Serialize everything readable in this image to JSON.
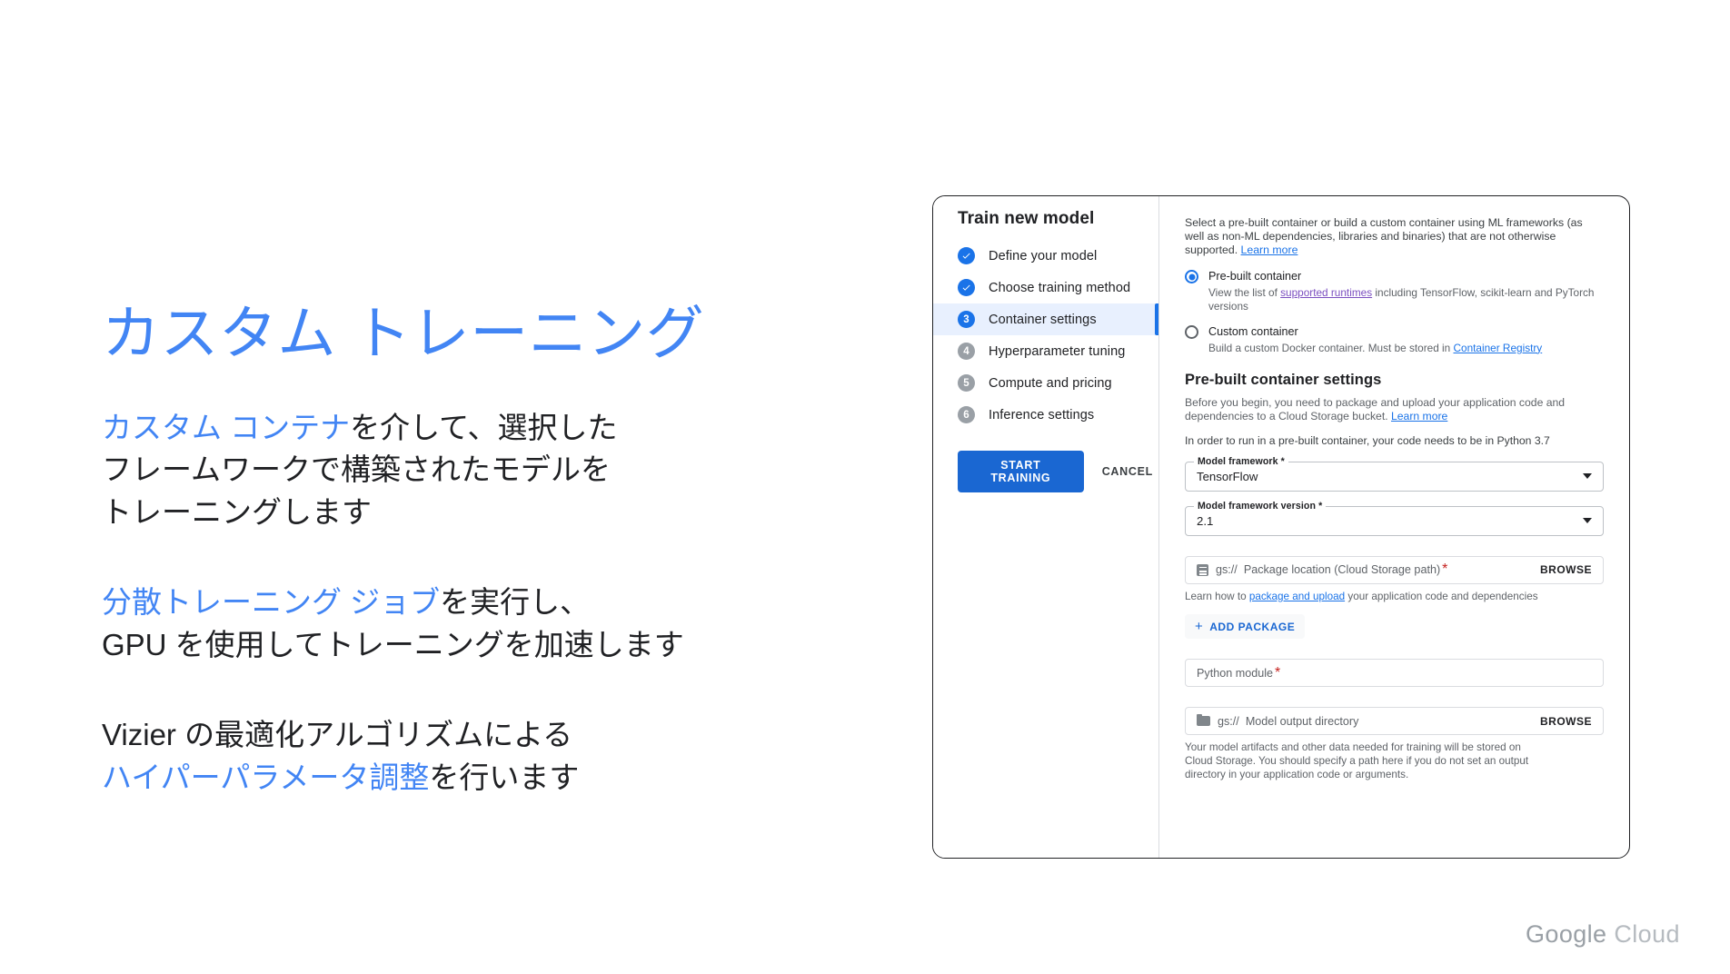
{
  "slide": {
    "headline": "カスタム トレーニング",
    "paragraphs": [
      {
        "lines": [
          {
            "segments": [
              {
                "text": "カスタム コンテナ",
                "accent": true
              },
              {
                "text": "を介して、選択した",
                "accent": false
              }
            ]
          },
          {
            "segments": [
              {
                "text": "フレームワークで構築されたモデルを",
                "accent": false
              }
            ]
          },
          {
            "segments": [
              {
                "text": "トレーニングします",
                "accent": false
              }
            ]
          }
        ]
      },
      {
        "lines": [
          {
            "segments": [
              {
                "text": "分散トレーニング ジョブ",
                "accent": true
              },
              {
                "text": "を実行し、",
                "accent": false
              }
            ]
          },
          {
            "segments": [
              {
                "text": "GPU を使用してトレーニングを加速します",
                "accent": false
              }
            ]
          }
        ]
      },
      {
        "lines": [
          {
            "segments": [
              {
                "text": "Vizier の最適化アルゴリズムによる",
                "accent": false
              }
            ]
          },
          {
            "segments": [
              {
                "text": "ハイパーパラメータ調整",
                "accent": true
              },
              {
                "text": "を行います",
                "accent": false
              }
            ]
          }
        ]
      }
    ],
    "logo": {
      "strong": "Google",
      "light": "Cloud"
    }
  },
  "dialog": {
    "nav": {
      "title": "Train new model",
      "steps": [
        {
          "number": "1",
          "label": "Define your model",
          "state": "done"
        },
        {
          "number": "2",
          "label": "Choose training method",
          "state": "done"
        },
        {
          "number": "3",
          "label": "Container settings",
          "state": "current"
        },
        {
          "number": "4",
          "label": "Hyperparameter tuning",
          "state": "todo"
        },
        {
          "number": "5",
          "label": "Compute and pricing",
          "state": "todo"
        },
        {
          "number": "6",
          "label": "Inference settings",
          "state": "todo"
        }
      ],
      "primary_button": "START TRAINING",
      "cancel_button": "CANCEL"
    },
    "pane": {
      "intro": {
        "text_before": "Select a pre-built container or build a custom container using ML frameworks (as well as non-ML dependencies, libraries and binaries) that are not otherwise supported. ",
        "link": "Learn more"
      },
      "container_options": [
        {
          "title": "Pre-built container",
          "selected": true,
          "sub_before": "View the list of ",
          "sub_link": "supported runtimes",
          "sub_after": " including TensorFlow, scikit-learn and PyTorch versions"
        },
        {
          "title": "Custom container",
          "selected": false,
          "sub_before": "Build a custom Docker container. Must be stored in ",
          "sub_link": "Container Registry",
          "sub_after": ""
        }
      ],
      "settings_title": "Pre-built container settings",
      "settings_desc_before": "Before you begin, you need to package and upload your application code and dependencies to a Cloud Storage bucket. ",
      "settings_desc_link": "Learn more",
      "settings_note": "In order to run in a pre-built container, your code needs to be in Python 3.7",
      "framework_field": {
        "label": "Model framework *",
        "value": "TensorFlow"
      },
      "framework_version_field": {
        "label": "Model framework version *",
        "value": "2.1"
      },
      "package_location": {
        "icon": "file-icon",
        "prefix": "gs://",
        "placeholder": "Package location (Cloud Storage path)",
        "required_mark": "*",
        "browse": "BROWSE",
        "helper_before": "Learn how to ",
        "helper_link": "package and upload",
        "helper_after": " your application code and dependencies"
      },
      "add_package_button": "ADD PACKAGE",
      "python_module": {
        "placeholder": "Python module",
        "required_mark": "*"
      },
      "model_output": {
        "icon": "folder-icon",
        "prefix": "gs://",
        "placeholder": "Model output directory",
        "browse": "BROWSE",
        "helper": "Your model artifacts and other data needed for training will be stored on Cloud Storage. You should specify a path here if you do not set an output directory in your application code or arguments."
      }
    }
  },
  "colors": {
    "accent_blue": "#4285f4",
    "link_blue": "#1a73e8",
    "primary_button": "#1a67d2",
    "selected_row": "#e8f0fe",
    "todo_badge": "#9aa0a6",
    "required_red": "#c5221f",
    "logo_gray": "#9aa0a6"
  }
}
